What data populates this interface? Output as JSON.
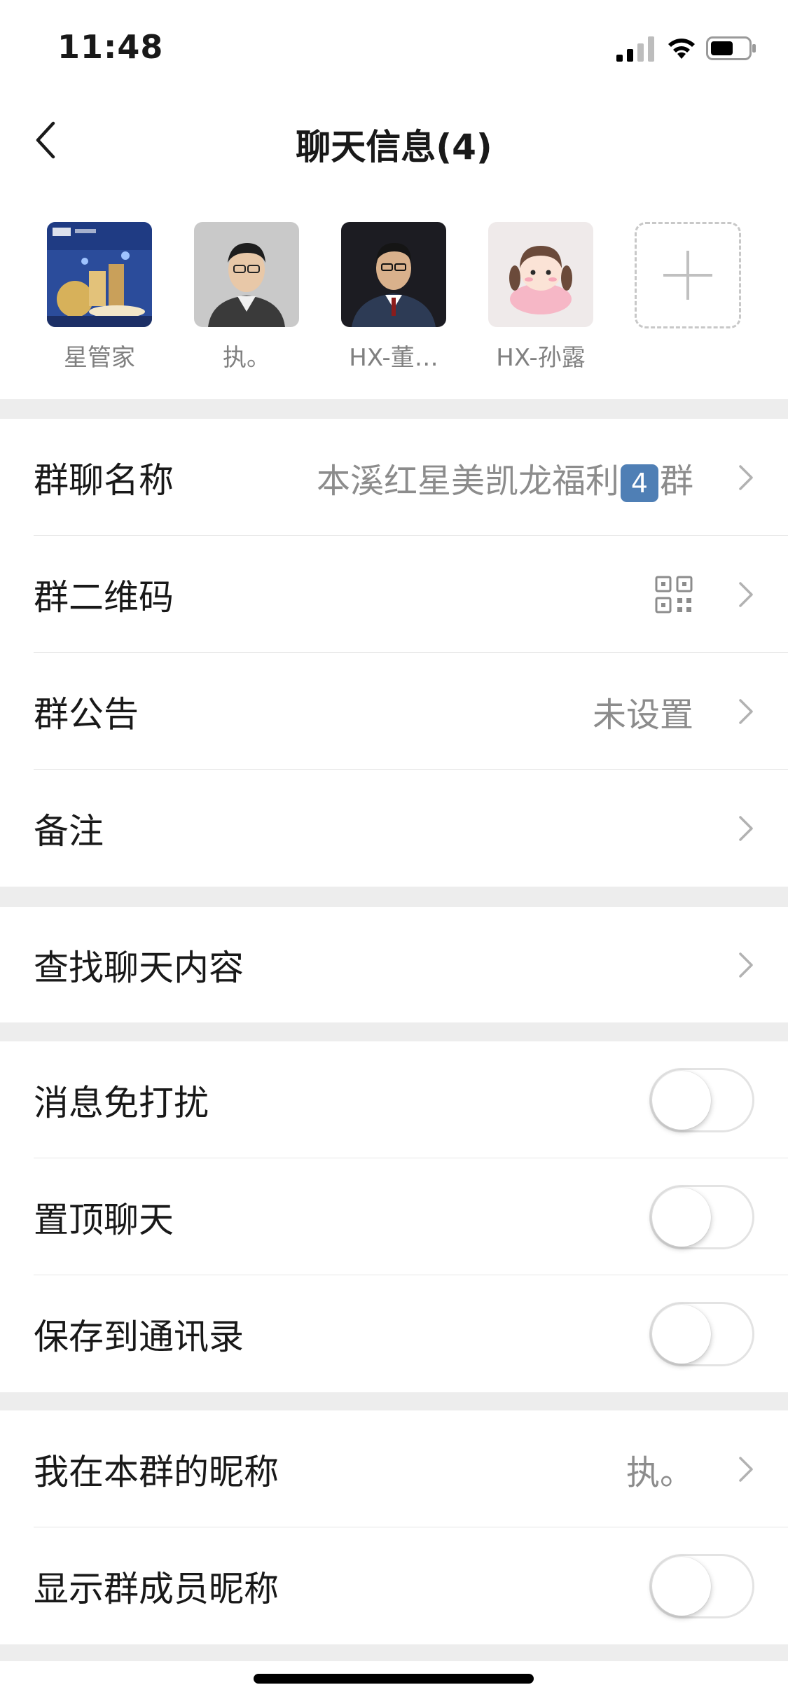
{
  "status_bar": {
    "time": "11:48"
  },
  "nav": {
    "title": "聊天信息(4)"
  },
  "members": [
    {
      "name": "星管家"
    },
    {
      "name": "执。"
    },
    {
      "name": "HX-董…"
    },
    {
      "name": "HX-孙露"
    }
  ],
  "group_section": {
    "name_label": "群聊名称",
    "name_value_part1": "本溪红星美凯龙福利",
    "name_value_badge": "4",
    "name_value_part2": "群",
    "qr_label": "群二维码",
    "notice_label": "群公告",
    "notice_value": "未设置",
    "remark_label": "备注"
  },
  "search_section": {
    "search_label": "查找聊天内容"
  },
  "toggle_section": {
    "mute_label": "消息免打扰",
    "mute_on": false,
    "pin_label": "置顶聊天",
    "pin_on": false,
    "save_label": "保存到通讯录",
    "save_on": false
  },
  "nickname_section": {
    "my_nick_label": "我在本群的昵称",
    "my_nick_value": "执。",
    "show_nick_label": "显示群成员昵称",
    "show_nick_on": false
  },
  "colors": {
    "background": "#ededed",
    "toggle_off": "#ffffff",
    "secondary_text": "#8c8c8c"
  }
}
